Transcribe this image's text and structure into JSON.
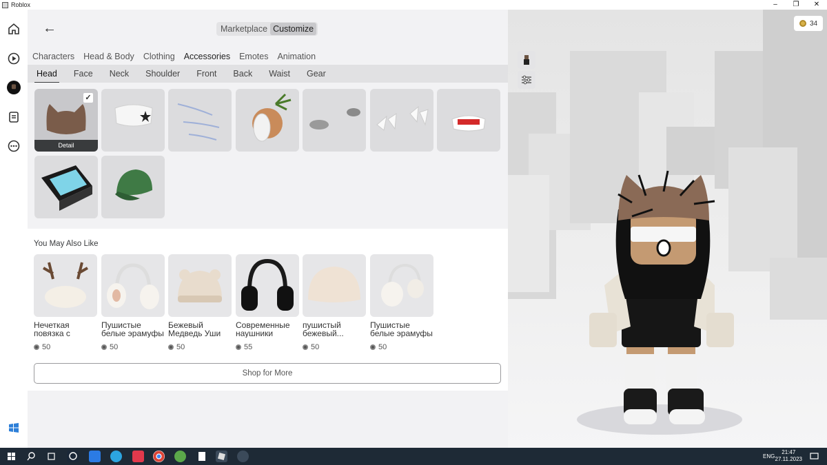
{
  "window": {
    "title": "Roblox",
    "min": "–",
    "restore": "❐",
    "close": "✕"
  },
  "nav": {
    "back": "←"
  },
  "mode": {
    "marketplace": "Marketplace",
    "customize": "Customize"
  },
  "categories": [
    "Characters",
    "Head & Body",
    "Clothing",
    "Accessories",
    "Emotes",
    "Animation"
  ],
  "active_category": "Accessories",
  "subcategories": [
    "Head",
    "Face",
    "Neck",
    "Shoulder",
    "Front",
    "Back",
    "Waist",
    "Gear"
  ],
  "active_subcategory": "Head",
  "inventory": {
    "detail_label": "Detail"
  },
  "recommendations": {
    "title": "You May Also Like",
    "items": [
      {
        "name": "Нечеткая повязка с",
        "price": "50"
      },
      {
        "name": "Пушистые белые эрамуфы",
        "price": "50"
      },
      {
        "name": "Бежевый Медведь Уши",
        "price": "50"
      },
      {
        "name": "Современные наушники",
        "price": "55"
      },
      {
        "name": "пушистый бежевый...",
        "price": "50"
      },
      {
        "name": "Пушистые белые эрамуфы",
        "price": "50"
      }
    ],
    "shop_more": "Shop for More"
  },
  "robux": {
    "balance": "34"
  },
  "taskbar": {
    "lang": "ENG",
    "time": "21:47",
    "date": "27.11.2023"
  },
  "colors": {
    "accent": "#393b3d",
    "taskbar": "#1e2a36",
    "robux_gold": "#d8b24a"
  }
}
